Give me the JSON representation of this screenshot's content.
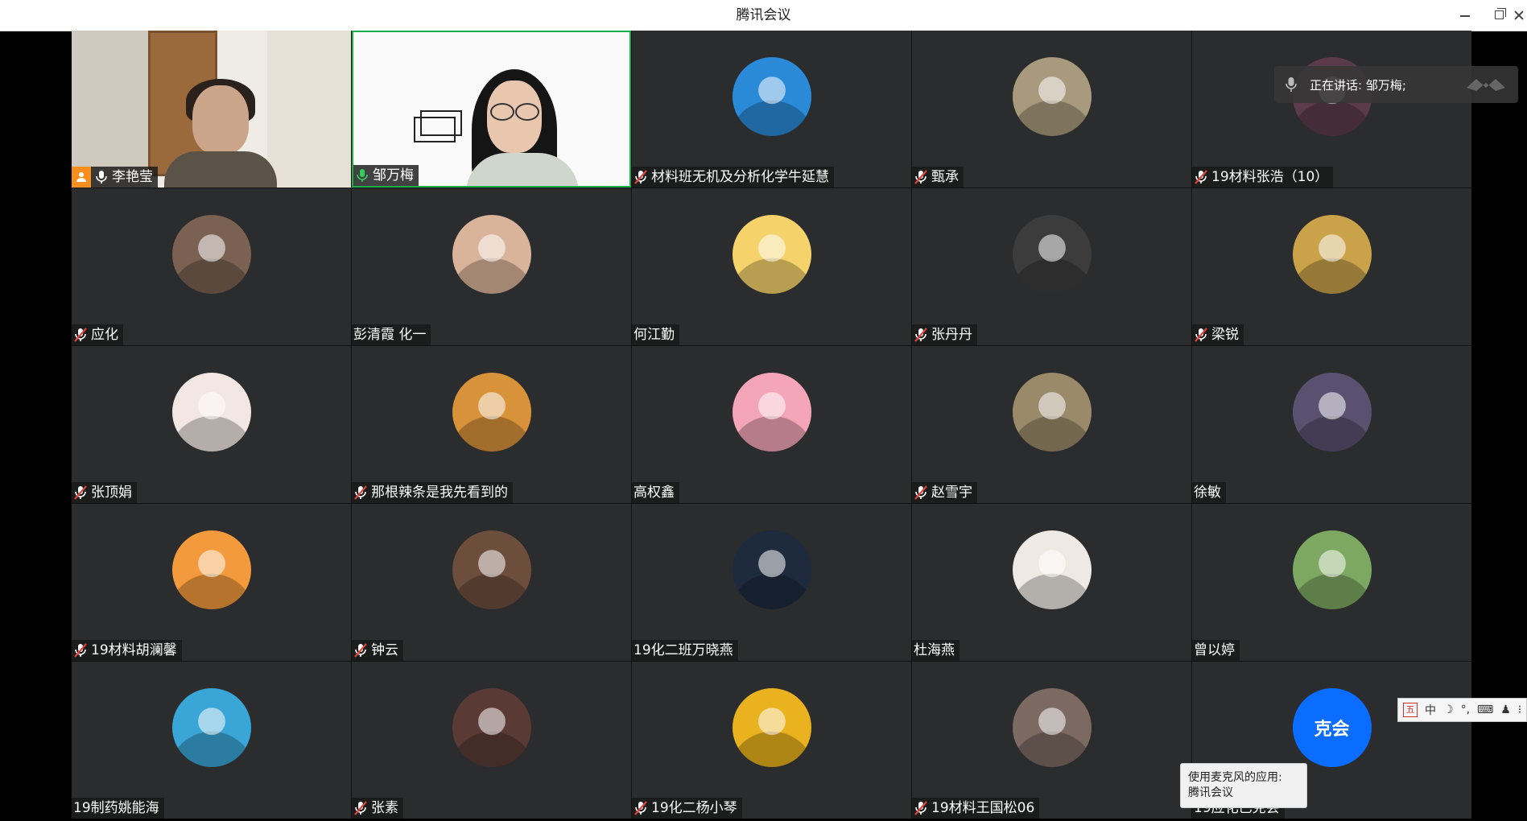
{
  "window": {
    "title": "腾讯会议"
  },
  "colors": {
    "tile_bg": "#2b2c2e",
    "host_badge": "#f78f1e",
    "active_speaker_border": "#1aad4b",
    "avatar_text_bg": "#0b6dff"
  },
  "speaking_indicator": {
    "text": "正在讲话: 邹万梅;"
  },
  "tooltip": {
    "line1": "使用麦克风的应用:",
    "line2": "腾讯会议"
  },
  "ime_bar": {
    "mode": "中"
  },
  "participants": [
    {
      "name": "李艳莹",
      "mic": "on",
      "host": true,
      "video": "room"
    },
    {
      "name": "邹万梅",
      "mic": "active",
      "video": "slide"
    },
    {
      "name": "材料班无机及分析化学牛延慧",
      "mic": "muted",
      "avatar_color": "#2a8ad8"
    },
    {
      "name": "甄承",
      "mic": "muted",
      "avatar_color": "#a89a7c"
    },
    {
      "name": "19材料张浩（10）",
      "mic": "muted",
      "avatar_color": "#5b3a4a"
    },
    {
      "name": "应化",
      "mic": "muted",
      "avatar_color": "#7a6152"
    },
    {
      "name": "彭清霞 化一",
      "mic": "none",
      "avatar_color": "#d9b49a"
    },
    {
      "name": "何江勤",
      "mic": "none",
      "avatar_color": "#f5d36a"
    },
    {
      "name": "张丹丹",
      "mic": "muted",
      "avatar_color": "#3c3c3c"
    },
    {
      "name": "梁锐",
      "mic": "muted",
      "avatar_color": "#c9a24a"
    },
    {
      "name": "张顶娟",
      "mic": "muted",
      "avatar_color": "#f2e7e2"
    },
    {
      "name": "那根辣条是我先看到的",
      "mic": "muted",
      "avatar_color": "#d8923a"
    },
    {
      "name": "高权鑫",
      "mic": "none",
      "avatar_color": "#f4a6b8"
    },
    {
      "name": "赵雪宇",
      "mic": "muted",
      "avatar_color": "#9a8a6a"
    },
    {
      "name": "徐敏",
      "mic": "none",
      "avatar_color": "#5a5070"
    },
    {
      "name": "19材料胡澜馨",
      "mic": "muted",
      "avatar_color": "#f39a3c"
    },
    {
      "name": "钟云",
      "mic": "muted",
      "avatar_color": "#6d4e3d"
    },
    {
      "name": "19化二班万晓燕",
      "mic": "none",
      "avatar_color": "#1e2a3e"
    },
    {
      "name": "杜海燕",
      "mic": "none",
      "avatar_color": "#efe9e3"
    },
    {
      "name": "曾以婷",
      "mic": "none",
      "avatar_color": "#7da861"
    },
    {
      "name": "19制药姚能海",
      "mic": "none",
      "avatar_color": "#3aa6d8"
    },
    {
      "name": "张素",
      "mic": "muted",
      "avatar_color": "#5a3a34"
    },
    {
      "name": "19化二杨小琴",
      "mic": "muted",
      "avatar_color": "#e9b21e"
    },
    {
      "name": "19材料王国松06",
      "mic": "muted",
      "avatar_color": "#7c6a62"
    },
    {
      "name": "19应化已克会",
      "mic": "none",
      "avatar_text": "克会",
      "avatar_color": "#0b6dff"
    }
  ]
}
